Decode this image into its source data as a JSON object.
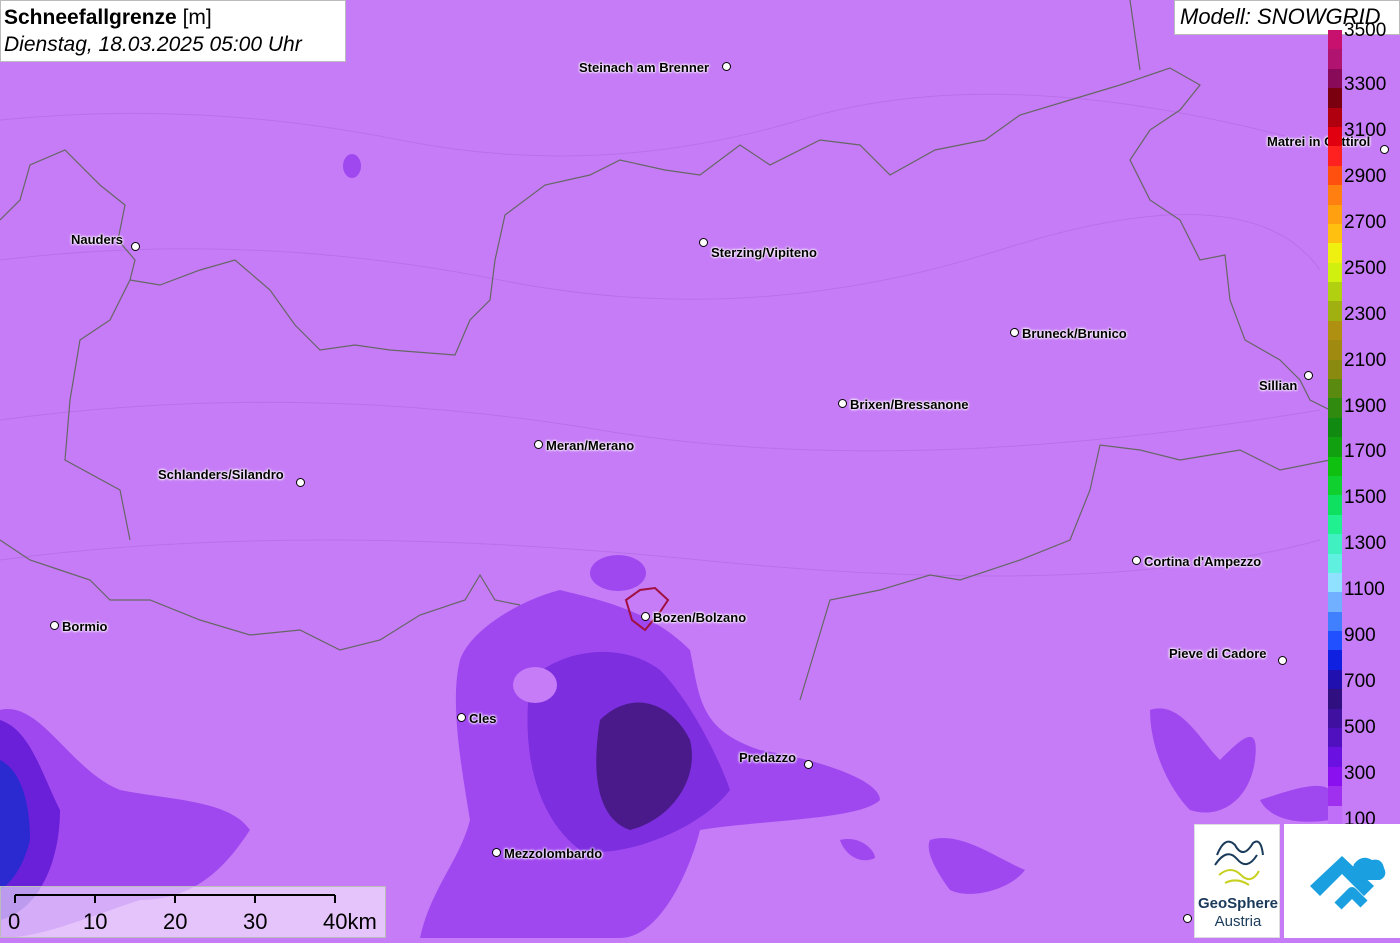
{
  "title": {
    "main": "Schneefallgrenze",
    "unit": "[m]",
    "datetime": "Dienstag, 18.03.2025 05:00 Uhr"
  },
  "model_label": "Modell: SNOWGRID",
  "cities": [
    {
      "id": "steinach",
      "label": "Steinach am Brenner"
    },
    {
      "id": "nauders",
      "label": "Nauders"
    },
    {
      "id": "sterzing",
      "label": "Sterzing/Vipiteno"
    },
    {
      "id": "bruneck",
      "label": "Bruneck/Brunico"
    },
    {
      "id": "matrei",
      "label": "Matrei in Osttirol"
    },
    {
      "id": "sillian",
      "label": "Sillian"
    },
    {
      "id": "brixen",
      "label": "Brixen/Bressanone"
    },
    {
      "id": "meran",
      "label": "Meran/Merano"
    },
    {
      "id": "schlanders",
      "label": "Schlanders/Silandro"
    },
    {
      "id": "cortina",
      "label": "Cortina d'Ampezzo"
    },
    {
      "id": "bormio",
      "label": "Bormio"
    },
    {
      "id": "bozen",
      "label": "Bozen/Bolzano"
    },
    {
      "id": "pieve",
      "label": "Pieve di Cadore"
    },
    {
      "id": "cles",
      "label": "Cles"
    },
    {
      "id": "predazzo",
      "label": "Predazzo"
    },
    {
      "id": "mezzolombardo",
      "label": "Mezzolombardo"
    }
  ],
  "legend": {
    "labels": [
      "3500",
      "3300",
      "3100",
      "2900",
      "2700",
      "2500",
      "2300",
      "2100",
      "1900",
      "1700",
      "1500",
      "1300",
      "1100",
      "900",
      "700",
      "500",
      "300",
      "100"
    ],
    "colors": [
      "#c8106e",
      "#b01470",
      "#8a0a5a",
      "#7a0010",
      "#b00010",
      "#e00010",
      "#ff2020",
      "#ff5010",
      "#ff8010",
      "#ffa010",
      "#ffc010",
      "#f0f010",
      "#d0f010",
      "#b0d010",
      "#a0b010",
      "#b09010",
      "#a08a10",
      "#8a8a10",
      "#5a8a10",
      "#308a10",
      "#108a10",
      "#10a010",
      "#10c010",
      "#10d030",
      "#10e060",
      "#20f090",
      "#40f0c0",
      "#60f0e0",
      "#90e0ff",
      "#70b0ff",
      "#4080ff",
      "#2050ff",
      "#1020e0",
      "#2010b0",
      "#301080",
      "#4010a0",
      "#5010c0",
      "#6a10e0",
      "#8a10f0",
      "#a030f0",
      "#c070f8"
    ],
    "accent_background": "#c67cf6"
  },
  "scalebar": {
    "ticks": [
      "0",
      "10",
      "20",
      "30",
      "40km"
    ]
  },
  "logos": {
    "geosphere_line1": "GeoSphere",
    "geosphere_line2": "Austria"
  }
}
